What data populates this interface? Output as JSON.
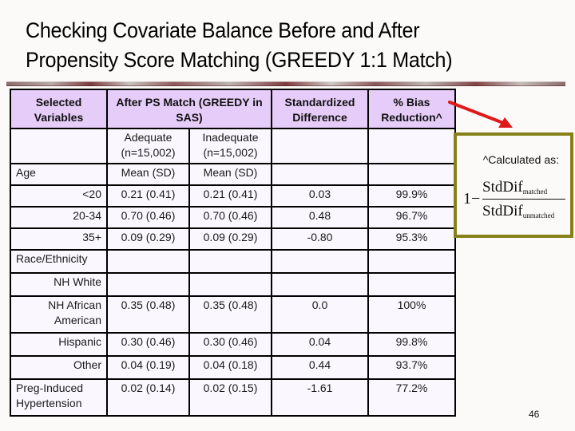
{
  "slide": {
    "title_lines": [
      "Checking Covariate Balance Before and After",
      "Propensity Score Matching (GREEDY 1:1 Match)"
    ],
    "page_number": "46"
  },
  "table": {
    "headers": {
      "selected_variables": "Selected Variables",
      "after_ps_match": "After PS Match (GREEDY in SAS)",
      "standardized_difference": "Standardized Difference",
      "bias_reduction": "% Bias Reduction^"
    },
    "subheaders": {
      "adequate": "Adequate (n=15,002)",
      "inadequate": "Inadequate (n=15,002)"
    },
    "age_row": {
      "label": "Age",
      "adequate": "Mean (SD)",
      "inadequate": "Mean (SD)"
    },
    "rows": [
      {
        "label": "<20",
        "adequate": "0.21 (0.41)",
        "inadequate": "0.21 (0.41)",
        "std_diff": "0.03",
        "bias_reduction": "99.9%"
      },
      {
        "label": "20-34",
        "adequate": "0.70 (0.46)",
        "inadequate": "0.70 (0.46)",
        "std_diff": "0.48",
        "bias_reduction": "96.7%"
      },
      {
        "label": "35+",
        "adequate": "0.09 (0.29)",
        "inadequate": "0.09 (0.29)",
        "std_diff": "-0.80",
        "bias_reduction": "95.3%"
      },
      {
        "label": "Race/Ethnicity",
        "adequate": "",
        "inadequate": "",
        "std_diff": "",
        "bias_reduction": ""
      },
      {
        "label": "NH White",
        "adequate": "",
        "inadequate": "",
        "std_diff": "",
        "bias_reduction": ""
      },
      {
        "label": "NH African American",
        "adequate": "0.35 (0.48)",
        "inadequate": "0.35 (0.48)",
        "std_diff": "0.0",
        "bias_reduction": "100%"
      },
      {
        "label": "Hispanic",
        "adequate": "0.30 (0.46)",
        "inadequate": "0.30 (0.46)",
        "std_diff": "0.04",
        "bias_reduction": "99.8%"
      },
      {
        "label": "Other",
        "adequate": "0.04 (0.19)",
        "inadequate": "0.04 (0.18)",
        "std_diff": "0.44",
        "bias_reduction": "93.7%"
      },
      {
        "label": "Preg-Induced Hypertension",
        "adequate": "0.02 (0.14)",
        "inadequate": "0.02 (0.15)",
        "std_diff": "-1.61",
        "bias_reduction": "77.2%"
      }
    ]
  },
  "callout": {
    "label": "^Calculated as:",
    "formula_one": "1",
    "formula_minus": "−",
    "numerator": "StdDif",
    "numerator_sub": "matched",
    "denominator": "StdDif",
    "denominator_sub": "unmatched"
  },
  "colors": {
    "header_bg": "#e6ccf8",
    "cell_bg": "#faf7fe",
    "callout_border": "#85801a",
    "arrow": "#e01818"
  }
}
